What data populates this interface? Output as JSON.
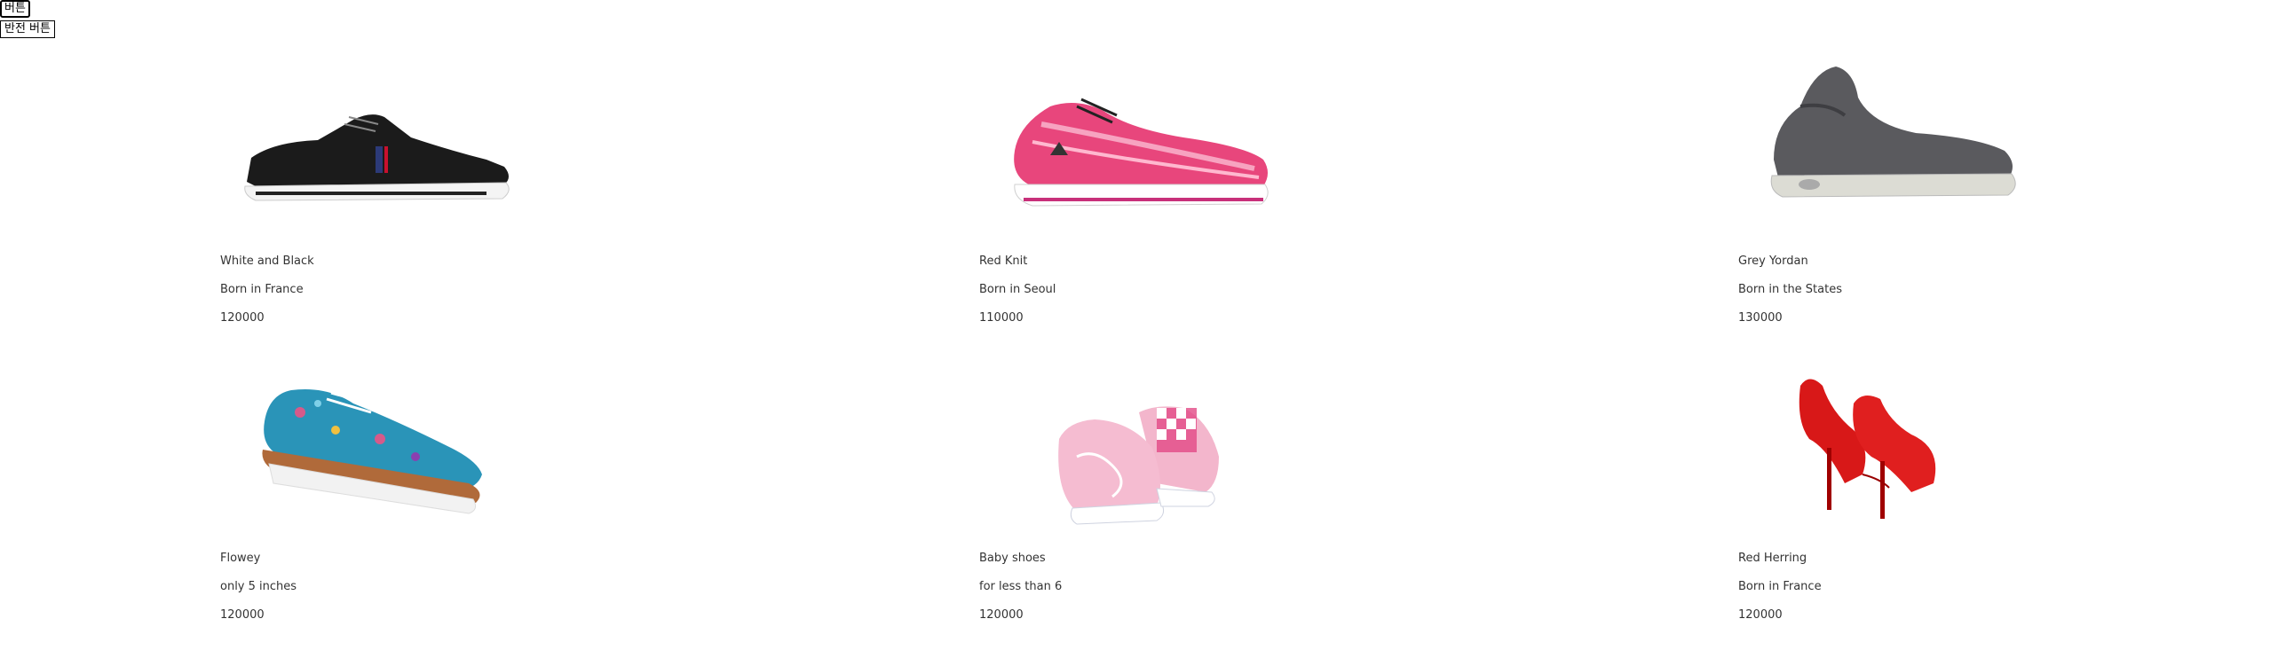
{
  "buttons": {
    "toggle_label": "버튼",
    "reverse_label": "반전 버튼"
  },
  "products": [
    {
      "name": "White and Black",
      "origin": "Born in France",
      "price": "120000",
      "icon": "sneaker-black-icon"
    },
    {
      "name": "Red Knit",
      "origin": "Born in Seoul",
      "price": "110000",
      "icon": "running-shoe-pink-icon"
    },
    {
      "name": "Grey Yordan",
      "origin": "Born in the States",
      "price": "130000",
      "icon": "high-top-grey-icon"
    },
    {
      "name": "Flowey",
      "origin": "only 5 inches",
      "price": "120000",
      "icon": "floral-shoe-blue-icon"
    },
    {
      "name": "Baby shoes",
      "origin": "for less than 6",
      "price": "120000",
      "icon": "slip-on-pink-icon"
    },
    {
      "name": "Red Herring",
      "origin": "Born in France",
      "price": "120000",
      "icon": "red-heels-icon"
    }
  ]
}
